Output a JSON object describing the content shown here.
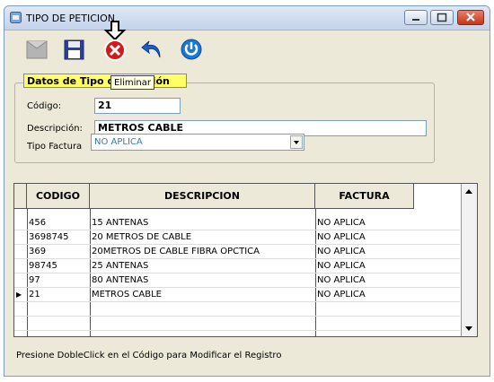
{
  "window": {
    "title": "TIPO DE PETICION",
    "minimize_glyph": "—",
    "maximize_glyph": "□",
    "close_glyph": "✕"
  },
  "toolbar": {
    "icons": [
      "new-icon",
      "save-icon",
      "delete-icon",
      "undo-icon",
      "power-icon"
    ],
    "tooltip": "Eliminar"
  },
  "form": {
    "group_title": "Datos de Tipo de Petición",
    "codigo_label": "Código:",
    "codigo_value": "21",
    "descripcion_label": "Descripción:",
    "descripcion_value": "METROS CABLE",
    "tipo_factura_label": "Tipo Factura",
    "tipo_factura_value": "NO APLICA"
  },
  "grid": {
    "headers": [
      "CODIGO",
      "DESCRIPCION",
      "FACTURA"
    ],
    "rows": [
      {
        "codigo": "456",
        "descripcion": "15 ANTENAS",
        "factura": "NO APLICA"
      },
      {
        "codigo": "3698745",
        "descripcion": "20 METROS DE CABLE",
        "factura": "NO APLICA"
      },
      {
        "codigo": "369",
        "descripcion": "20METROS DE CABLE FIBRA OPCTICA",
        "factura": "NO APLICA"
      },
      {
        "codigo": "98745",
        "descripcion": "25 ANTENAS",
        "factura": "NO APLICA"
      },
      {
        "codigo": "97",
        "descripcion": "80 ANTENAS",
        "factura": "NO APLICA"
      },
      {
        "codigo": "21",
        "descripcion": "METROS CABLE",
        "factura": "NO APLICA"
      }
    ],
    "current_row_marker": "▶"
  },
  "status_text": "Presione DobleClick en el Código para Modificar el Registro",
  "colors": {
    "group_title_bg": "#ffff66",
    "close_button": "#c2361c",
    "save_icon": "#2b3f9c",
    "delete_icon": "#d11a1a",
    "undo_icon": "#1c5fc7",
    "power_icon": "#1a78d6"
  }
}
